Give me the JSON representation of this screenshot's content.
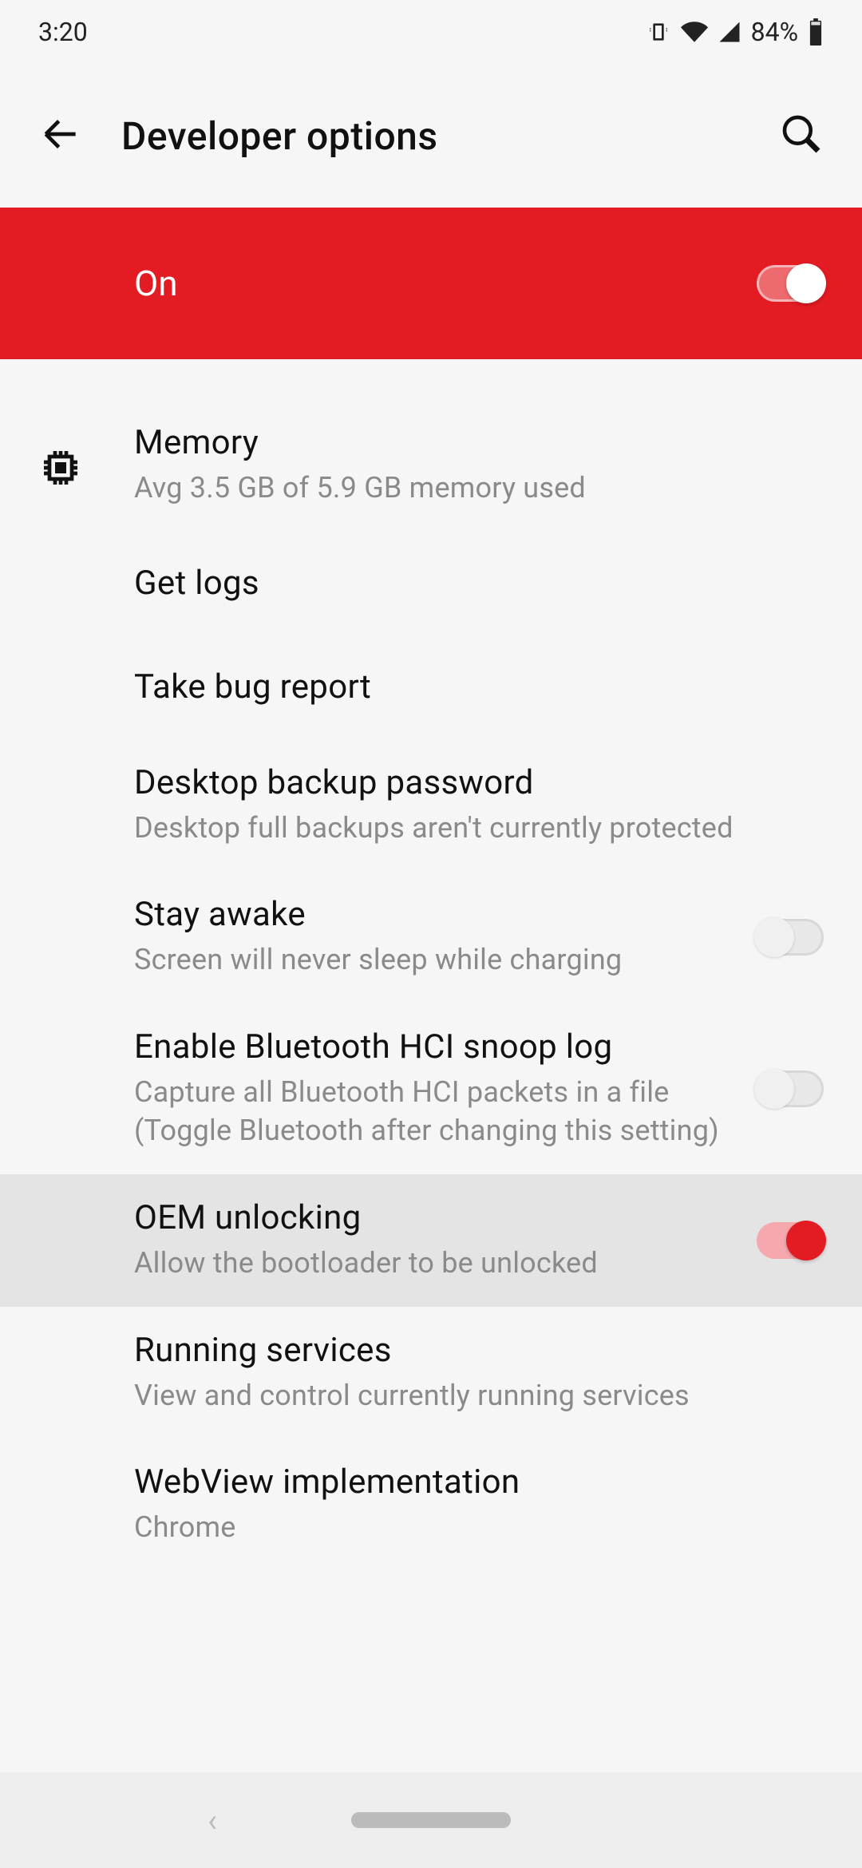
{
  "statusbar": {
    "time": "3:20",
    "battery_pct": "84%"
  },
  "header": {
    "title": "Developer options"
  },
  "master": {
    "label": "On",
    "enabled": true
  },
  "items": {
    "memory": {
      "title": "Memory",
      "sub": "Avg 3.5 GB of 5.9 GB memory used"
    },
    "getlogs": {
      "title": "Get logs"
    },
    "bugreport": {
      "title": "Take bug report"
    },
    "backuppw": {
      "title": "Desktop backup password",
      "sub": "Desktop full backups aren't currently protected"
    },
    "stayawake": {
      "title": "Stay awake",
      "sub": "Screen will never sleep while charging",
      "enabled": false
    },
    "btsnoop": {
      "title": "Enable Bluetooth HCI snoop log",
      "sub": "Capture all Bluetooth HCI packets in a file (Toggle Bluetooth after changing this setting)",
      "enabled": false
    },
    "oem": {
      "title": "OEM unlocking",
      "sub": "Allow the bootloader to be unlocked",
      "enabled": true
    },
    "running": {
      "title": "Running services",
      "sub": "View and control currently running services"
    },
    "webview": {
      "title": "WebView implementation",
      "sub": "Chrome"
    }
  }
}
